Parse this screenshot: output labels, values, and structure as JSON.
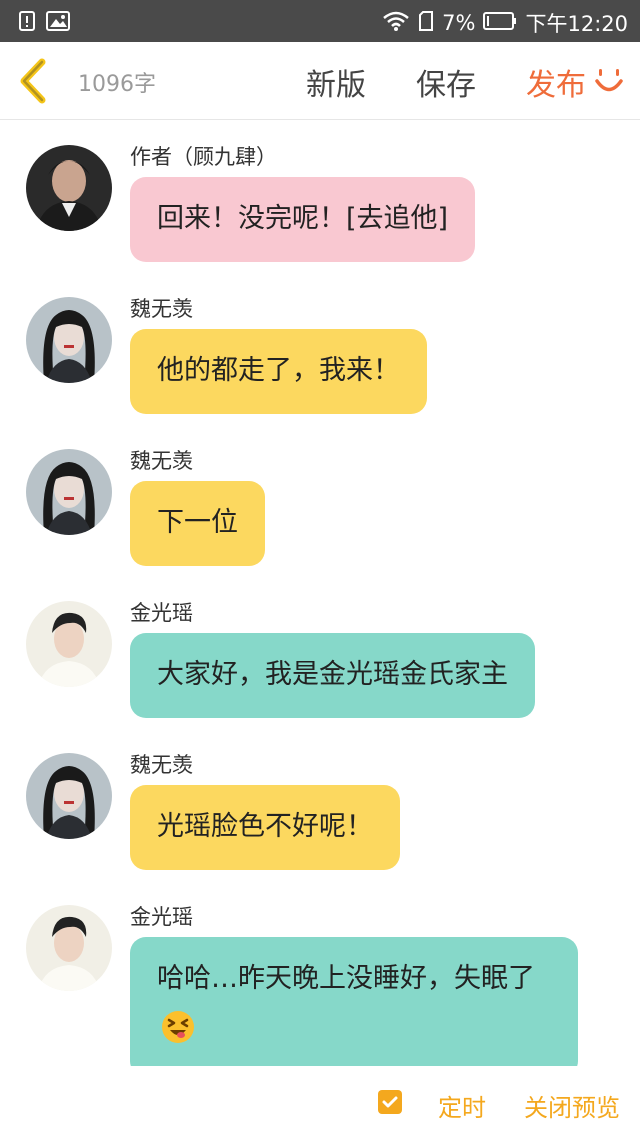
{
  "statusbar": {
    "battery_percent": "7%",
    "time": "下午12:20",
    "icons": [
      "battery-alert-icon",
      "image-icon",
      "wifi-icon",
      "sim-icon",
      "battery-icon"
    ]
  },
  "header": {
    "word_count": "1096字",
    "new_version_label": "新版",
    "save_label": "保存",
    "publish_label": "发布",
    "accent_color": "#ef6c3a"
  },
  "messages": [
    {
      "name": "作者（顾九肆）",
      "text": "回来！没完呢！[去追他]",
      "bubble_color": "#f9c8d1"
    },
    {
      "name": "魏无羡",
      "text": "他的都走了，我来！",
      "bubble_color": "#fcd85f"
    },
    {
      "name": "魏无羡",
      "text": "下一位",
      "bubble_color": "#fcd85f"
    },
    {
      "name": "金光瑶",
      "text": "大家好，我是金光瑶金氏家主",
      "bubble_color": "#86d8c9"
    },
    {
      "name": "魏无羡",
      "text": "光瑶脸色不好呢！",
      "bubble_color": "#fcd85f"
    },
    {
      "name": "金光瑶",
      "text": "哈哈…昨天晚上没睡好，失眠了",
      "bubble_color": "#86d8c9"
    }
  ],
  "footer": {
    "timer_label": "定时",
    "close_preview_label": "关闭预览",
    "timer_checked": true,
    "accent_color": "#f4a81e"
  }
}
